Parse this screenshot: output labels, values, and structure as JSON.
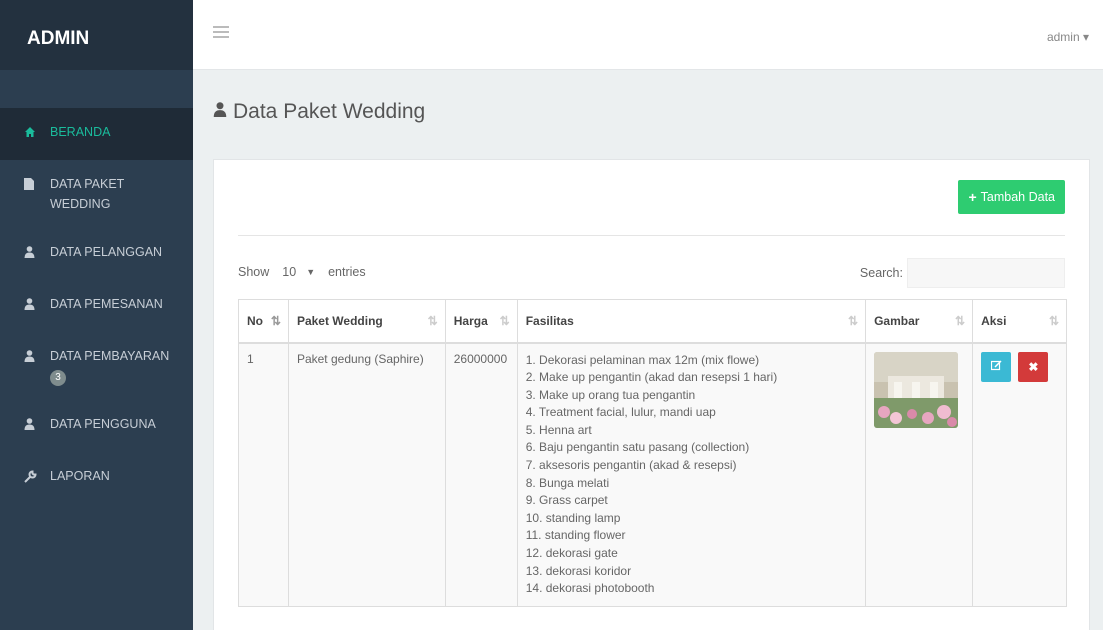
{
  "sidebar": {
    "brand": "ADMIN",
    "items": [
      {
        "label": "BERANDA",
        "icon": "home-icon",
        "active": true
      },
      {
        "label": "DATA PAKET WEDDING",
        "icon": "file-icon"
      },
      {
        "label": "DATA PELANGGAN",
        "icon": "user-icon"
      },
      {
        "label": "DATA PEMESANAN",
        "icon": "user-icon"
      },
      {
        "label": "DATA PEMBAYARAN",
        "icon": "user-icon",
        "badge": "3"
      },
      {
        "label": "DATA PENGGUNA",
        "icon": "user-icon"
      },
      {
        "label": "LAPORAN",
        "icon": "wrench-icon"
      }
    ]
  },
  "topbar": {
    "user": "admin ▾"
  },
  "page": {
    "title": "Data Paket Wedding",
    "title_icon": "user-icon"
  },
  "panel": {
    "add_button": "Tambah Data",
    "length": {
      "show": "Show",
      "value": "10",
      "entries": "entries"
    },
    "search_label": "Search:"
  },
  "table": {
    "headers": [
      "No",
      "Paket Wedding",
      "Harga",
      "Fasilitas",
      "Gambar",
      "Aksi"
    ],
    "rows": [
      {
        "no": "1",
        "paket": "Paket gedung (Saphire)",
        "harga": "26000000",
        "fasilitas": [
          "1. Dekorasi pelaminan max 12m (mix flowe)",
          "2. Make up pengantin (akad dan resepsi 1 hari)",
          "3. Make up orang tua pengantin",
          "4. Treatment facial, lulur, mandi uap",
          "5. Henna art",
          "6. Baju pengantin satu pasang (collection)",
          "7. aksesoris pengantin (akad & resepsi)",
          "8. Bunga melati",
          "9. Grass carpet",
          "10. standing lamp",
          "11. standing flower",
          "12. dekorasi gate",
          "13. dekorasi koridor",
          "14. dekorasi photobooth"
        ]
      }
    ]
  },
  "colors": {
    "sidebar": "#2c3e50",
    "active": "#1abc9c",
    "add": "#2ecc71",
    "edit": "#3bb9d4",
    "delete": "#d33a3a"
  }
}
